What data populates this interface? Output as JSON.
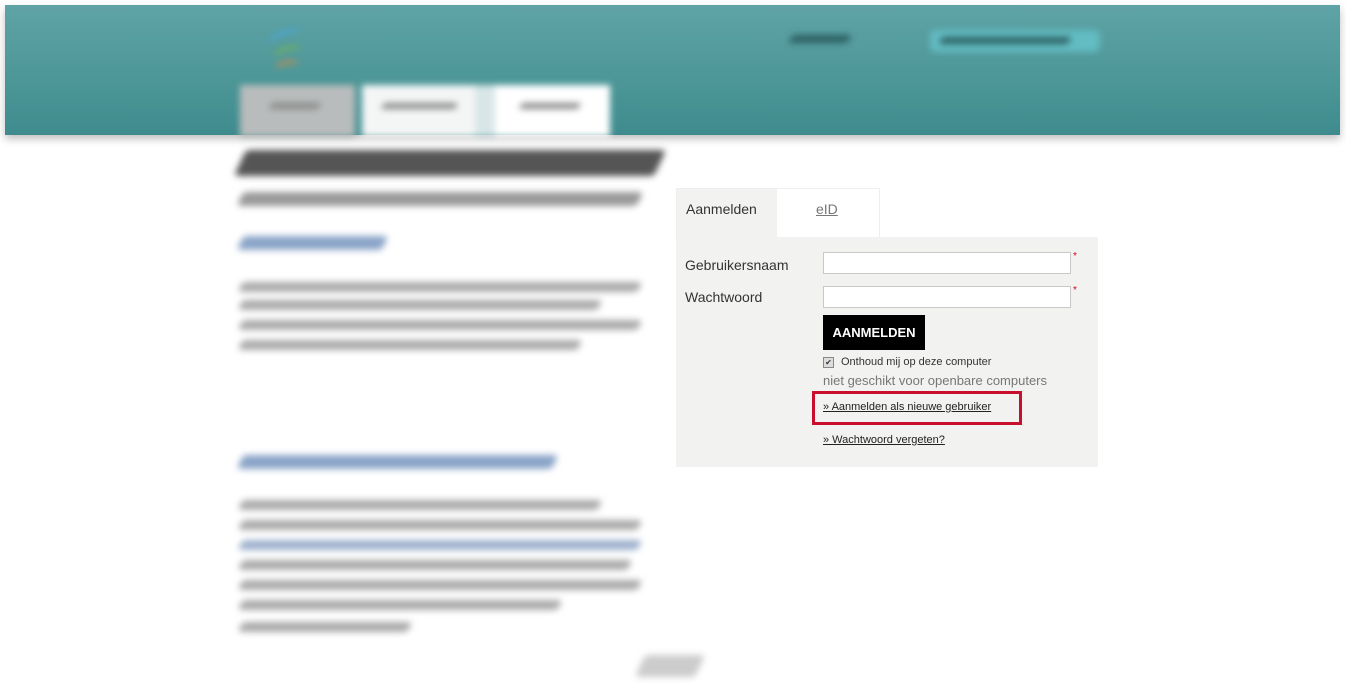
{
  "login": {
    "tabs": [
      {
        "label": "Aanmelden",
        "active": true
      },
      {
        "label": "eID",
        "active": false
      }
    ],
    "username_label": "Gebruikersnaam",
    "password_label": "Wachtwoord",
    "username_value": "",
    "password_value": "",
    "required_marker": "*",
    "submit_label": "AANMELDEN",
    "remember_label": "Onthoud mij op deze computer",
    "remember_checked": true,
    "remember_note": "niet geschikt voor openbare computers",
    "register_link": "» Aanmelden als nieuwe gebruiker",
    "forgot_link": "» Wachtwoord vergeten?"
  },
  "colors": {
    "header_teal": "#4c9697",
    "highlight_red": "#c8102e",
    "panel_bg": "#f2f2f0"
  },
  "icons": {
    "logo": "brand-logo",
    "checkbox": "checkbox-checked-icon"
  }
}
